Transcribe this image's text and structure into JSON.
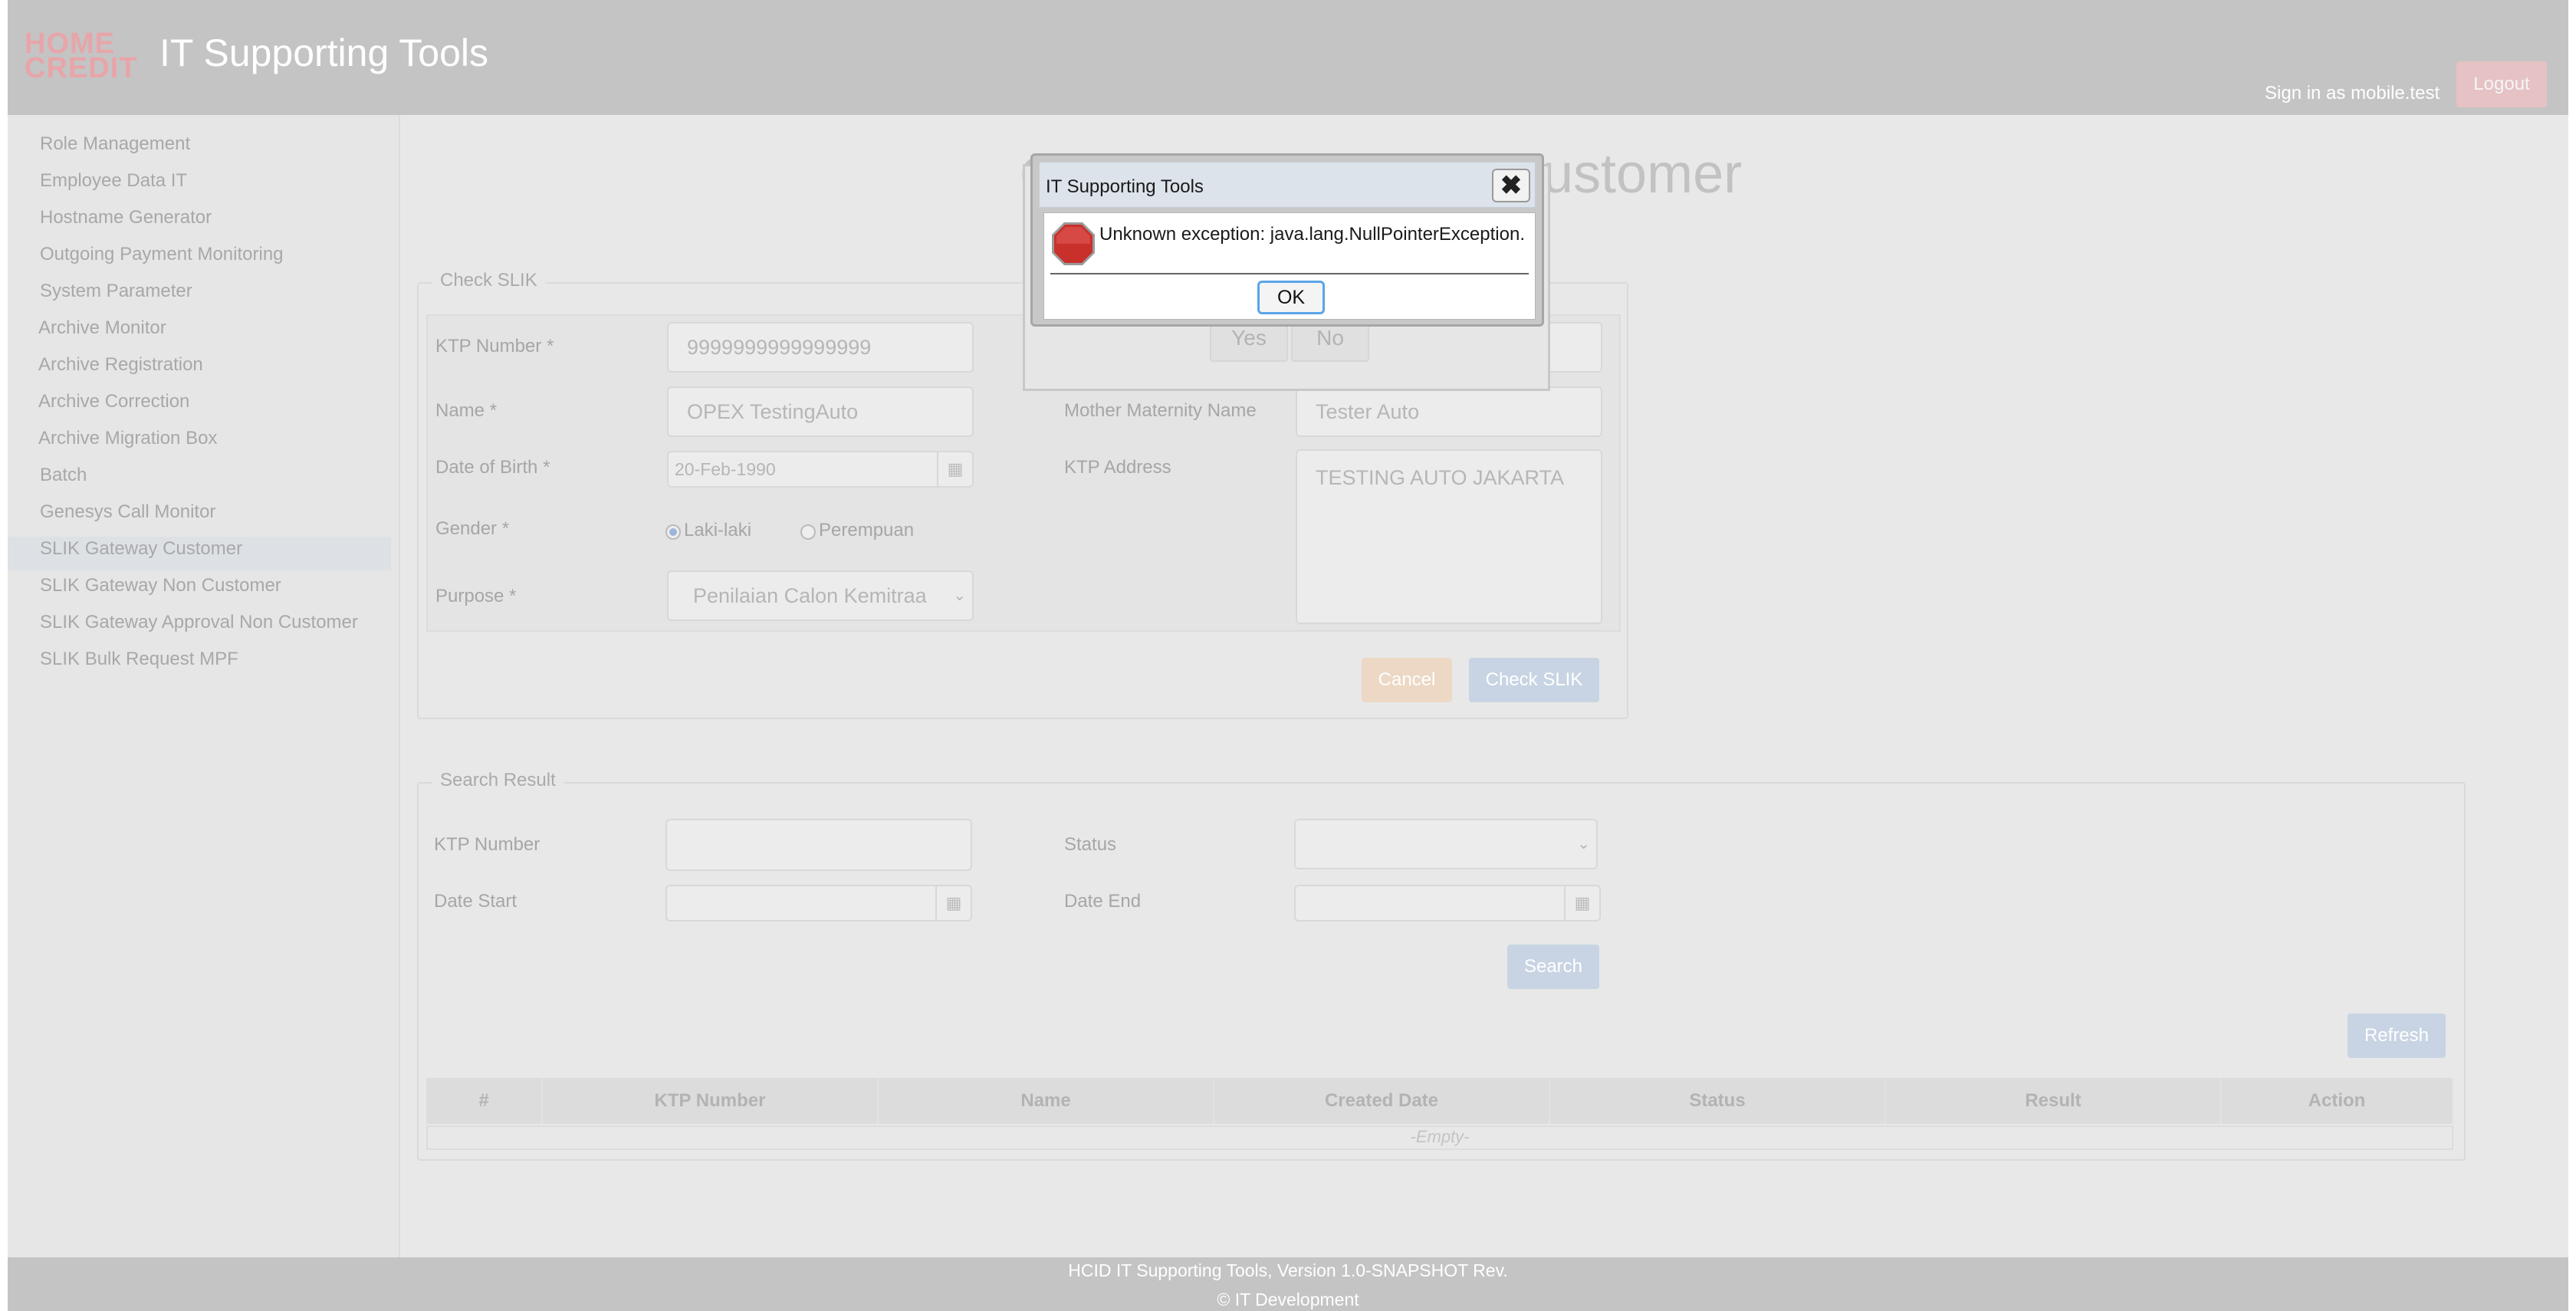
{
  "header": {
    "logo_line1": "HOME",
    "logo_line2": "CREDIT",
    "app_title": "IT Supporting Tools",
    "signin_text": "Sign in as mobile.test",
    "logout_label": "Logout"
  },
  "sidebar": {
    "items": [
      {
        "label": "Role Management"
      },
      {
        "label": "Employee Data IT"
      },
      {
        "label": "Hostname Generator"
      },
      {
        "label": "Outgoing Payment Monitoring"
      },
      {
        "label": "System Parameter"
      },
      {
        "label": "Archive Monitor"
      },
      {
        "label": "Archive Registration"
      },
      {
        "label": "Archive Correction"
      },
      {
        "label": "Archive Migration Box"
      },
      {
        "label": "Batch"
      },
      {
        "label": "Genesys Call Monitor"
      },
      {
        "label": "SLIK Gateway Customer"
      },
      {
        "label": "SLIK Gateway Non Customer"
      },
      {
        "label": "SLIK Gateway Approval Non Customer"
      },
      {
        "label": "SLIK Bulk Request MPF"
      }
    ],
    "active_index": 11
  },
  "page": {
    "title": "Customer",
    "title_prefix": "C"
  },
  "check_slik": {
    "legend": "Check SLIK",
    "ktp_label": "KTP Number *",
    "ktp_value": "9999999999999999",
    "name_label": "Name *",
    "name_value": "OPEX TestingAuto",
    "dob_label": "Date of Birth *",
    "dob_value": "20-Feb-1990",
    "gender_label": "Gender *",
    "gender_opt1": "Laki-laki",
    "gender_opt2": "Perempuan",
    "purpose_label": "Purpose *",
    "purpose_value": "Penilaian Calon Kemitraa",
    "mother_label": "Mother Maternity Name",
    "mother_value": "Tester Auto",
    "address_label": "KTP Address",
    "address_value": "TESTING AUTO JAKARTA",
    "cancel_label": "Cancel",
    "check_label": "Check SLIK"
  },
  "confirm_dialog": {
    "yes_label": "Yes",
    "no_label": "No"
  },
  "search_result": {
    "legend": "Search Result",
    "ktp_label": "KTP Number",
    "status_label": "Status",
    "date_start_label": "Date Start",
    "date_end_label": "Date End",
    "search_label": "Search",
    "refresh_label": "Refresh",
    "columns": [
      "#",
      "KTP Number",
      "Name",
      "Created Date",
      "Status",
      "Result",
      "Action"
    ],
    "empty_text": "-Empty-"
  },
  "alert": {
    "title": "IT Supporting Tools",
    "message": "Unknown exception: java.lang.NullPointerException.",
    "ok_label": "OK",
    "icon": "stop-icon"
  },
  "footer": {
    "version_text": "HCID IT Supporting Tools, Version 1.0-SNAPSHOT Rev.",
    "copyright_text": "© IT Development"
  }
}
